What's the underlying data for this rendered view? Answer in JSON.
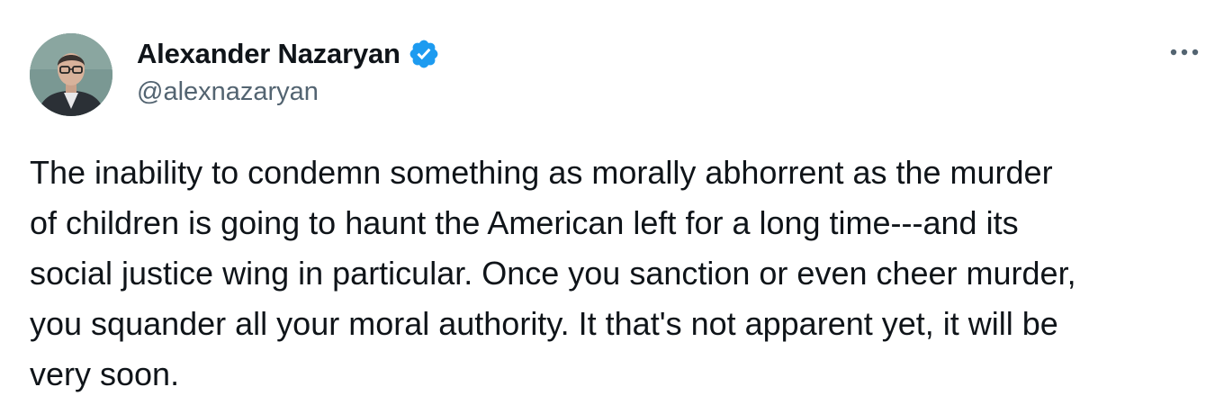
{
  "tweet": {
    "author": {
      "display_name": "Alexander Nazaryan",
      "handle": "@alexnazaryan",
      "verified": true
    },
    "text_lines": [
      "The inability to condemn something as morally abhorrent as the murder",
      "of children is going to haunt the American left for a long time---and its",
      "social justice wing in particular. Once you sanction or even cheer murder,",
      "you squander all your moral authority. It that's not apparent yet, it will be",
      "very soon."
    ]
  },
  "icons": {
    "verified": "verified-badge-icon",
    "more": "more-options-icon",
    "avatar": "avatar-photo"
  },
  "colors": {
    "primary_text": "#0f1419",
    "secondary_text": "#536471",
    "verified_blue": "#1d9bf0",
    "background": "#ffffff"
  }
}
